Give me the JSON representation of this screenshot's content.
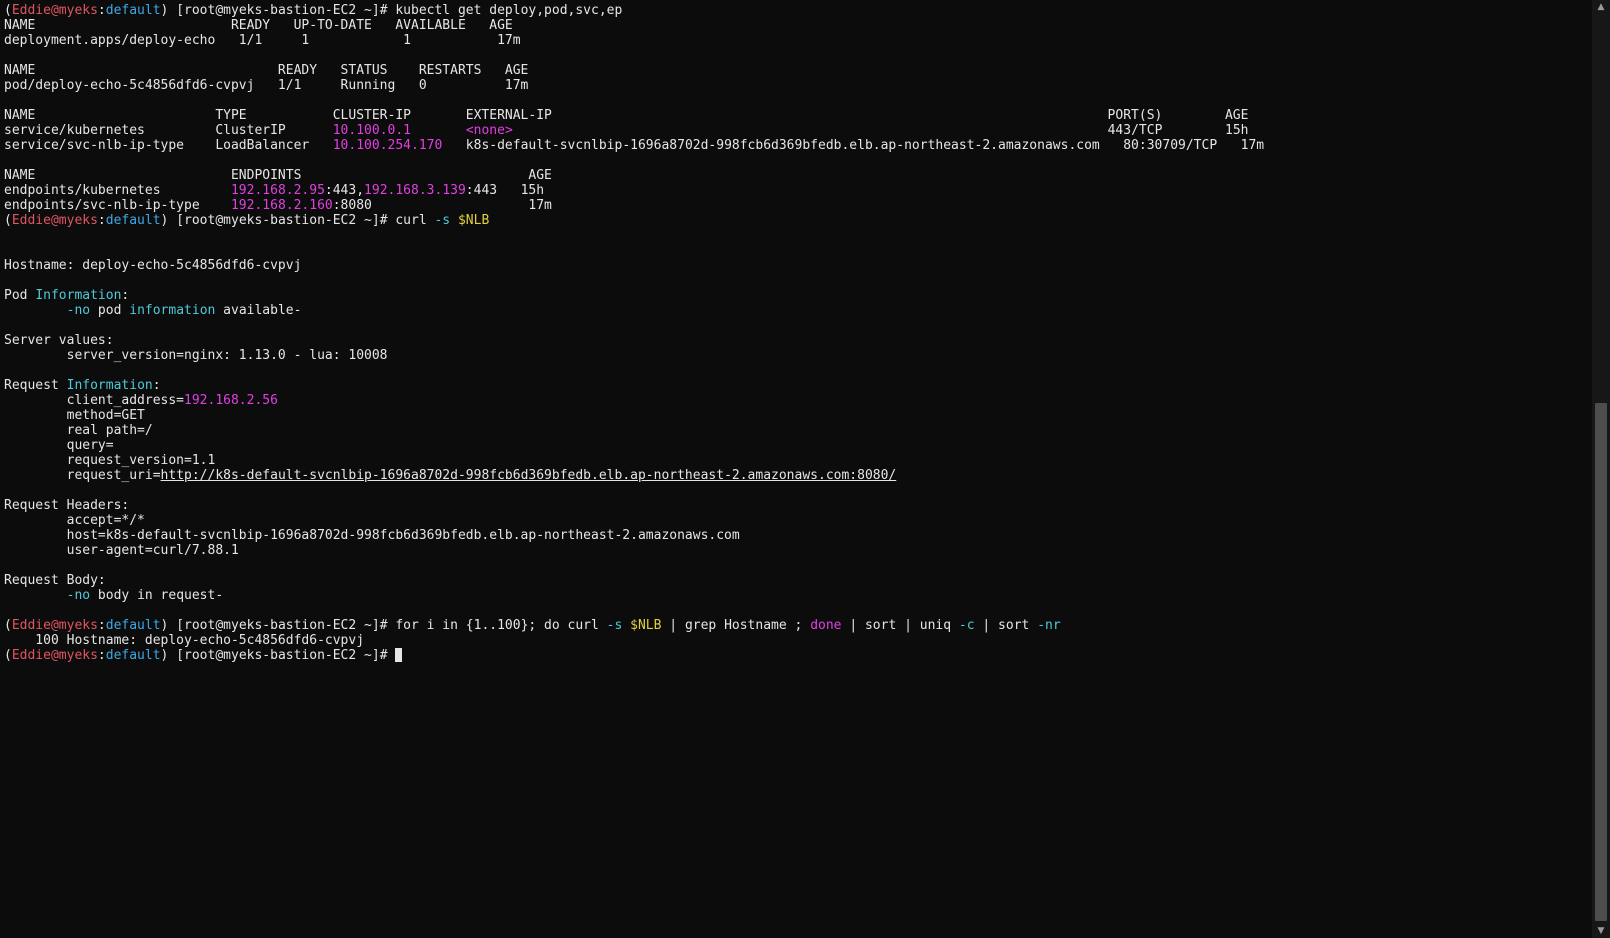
{
  "terminal": {
    "lines": [
      [
        {
          "t": "("
        },
        {
          "t": "Eddie@myeks",
          "c": "red"
        },
        {
          "t": ":"
        },
        {
          "t": "default",
          "c": "blue"
        },
        {
          "t": ") [root@myeks-bastion-EC2 ~]# kubectl get deploy,pod,svc,ep"
        }
      ],
      [
        {
          "t": "NAME                         READY   UP-TO-DATE   AVAILABLE   AGE"
        }
      ],
      [
        {
          "t": "deployment.apps/deploy-echo   1/1     1            1           17m"
        }
      ],
      [],
      [
        {
          "t": "NAME                               READY   STATUS    RESTARTS   AGE"
        }
      ],
      [
        {
          "t": "pod/deploy-echo-5c4856dfd6-cvpvj   1/1     Running   0          17m"
        }
      ],
      [],
      [
        {
          "t": "NAME                       TYPE           CLUSTER-IP       EXTERNAL-IP                                                                       PORT(S)        AGE"
        }
      ],
      [
        {
          "t": "service/kubernetes         ClusterIP      "
        },
        {
          "t": "10.100.0.1",
          "c": "magenta"
        },
        {
          "t": "       "
        },
        {
          "t": "<none>",
          "c": "magenta"
        },
        {
          "t": "                                                                            443/TCP        15h"
        }
      ],
      [
        {
          "t": "service/svc-nlb-ip-type    LoadBalancer   "
        },
        {
          "t": "10.100.254.170",
          "c": "magenta"
        },
        {
          "t": "   k8s-default-svcnlbip-1696a8702d-998fcb6d369bfedb.elb.ap-northeast-2.amazonaws.com   80:30709/TCP   17m"
        }
      ],
      [],
      [
        {
          "t": "NAME                         ENDPOINTS                             AGE"
        }
      ],
      [
        {
          "t": "endpoints/kubernetes         "
        },
        {
          "t": "192.168.2.95",
          "c": "magenta"
        },
        {
          "t": ":443,"
        },
        {
          "t": "192.168.3.139",
          "c": "magenta"
        },
        {
          "t": ":443   15h"
        }
      ],
      [
        {
          "t": "endpoints/svc-nlb-ip-type    "
        },
        {
          "t": "192.168.2.160",
          "c": "magenta"
        },
        {
          "t": ":8080                    17m"
        }
      ],
      [
        {
          "t": "("
        },
        {
          "t": "Eddie@myeks",
          "c": "red"
        },
        {
          "t": ":"
        },
        {
          "t": "default",
          "c": "blue"
        },
        {
          "t": ") [root@myeks-bastion-EC2 ~]# curl "
        },
        {
          "t": "-s",
          "c": "cyan"
        },
        {
          "t": " "
        },
        {
          "t": "$NLB",
          "c": "yellow"
        }
      ],
      [],
      [],
      [
        {
          "t": "Hostname: deploy-echo-5c4856dfd6-cvpvj"
        }
      ],
      [],
      [
        {
          "t": "Pod "
        },
        {
          "t": "Information",
          "c": "cyan"
        },
        {
          "t": ":"
        }
      ],
      [
        {
          "t": "        "
        },
        {
          "t": "-no",
          "c": "cyan"
        },
        {
          "t": " pod "
        },
        {
          "t": "information",
          "c": "cyan"
        },
        {
          "t": " available-"
        }
      ],
      [],
      [
        {
          "t": "Server values:"
        }
      ],
      [
        {
          "t": "        server_version=nginx: 1.13.0 - lua: 10008"
        }
      ],
      [],
      [
        {
          "t": "Request "
        },
        {
          "t": "Information",
          "c": "cyan"
        },
        {
          "t": ":"
        }
      ],
      [
        {
          "t": "        client_address="
        },
        {
          "t": "192.168.2.56",
          "c": "magenta"
        }
      ],
      [
        {
          "t": "        method=GET"
        }
      ],
      [
        {
          "t": "        real path=/"
        }
      ],
      [
        {
          "t": "        query="
        }
      ],
      [
        {
          "t": "        request_version=1.1"
        }
      ],
      [
        {
          "t": "        request_uri="
        },
        {
          "t": "http://k8s-default-svcnlbip-1696a8702d-998fcb6d369bfedb.elb.ap-northeast-2.amazonaws.com:8080/",
          "u": true
        }
      ],
      [],
      [
        {
          "t": "Request Headers:"
        }
      ],
      [
        {
          "t": "        accept=*/*"
        }
      ],
      [
        {
          "t": "        host=k8s-default-svcnlbip-1696a8702d-998fcb6d369bfedb.elb.ap-northeast-2.amazonaws.com"
        }
      ],
      [
        {
          "t": "        user-agent=curl/7.88.1"
        }
      ],
      [],
      [
        {
          "t": "Request Body:"
        }
      ],
      [
        {
          "t": "        "
        },
        {
          "t": "-no",
          "c": "cyan"
        },
        {
          "t": " body in request-"
        }
      ],
      [],
      [
        {
          "t": "("
        },
        {
          "t": "Eddie@myeks",
          "c": "red"
        },
        {
          "t": ":"
        },
        {
          "t": "default",
          "c": "blue"
        },
        {
          "t": ") [root@myeks-bastion-EC2 ~]# for i in {1..100}; do curl "
        },
        {
          "t": "-s",
          "c": "cyan"
        },
        {
          "t": " "
        },
        {
          "t": "$NLB",
          "c": "yellow"
        },
        {
          "t": " | grep Hostname ; "
        },
        {
          "t": "done",
          "c": "magenta"
        },
        {
          "t": " | sort | uniq "
        },
        {
          "t": "-c",
          "c": "cyan"
        },
        {
          "t": " | sort "
        },
        {
          "t": "-nr",
          "c": "cyan"
        }
      ],
      [
        {
          "t": "    100 Hostname: deploy-echo-5c4856dfd6-cvpvj"
        }
      ],
      [
        {
          "t": "("
        },
        {
          "t": "Eddie@myeks",
          "c": "red"
        },
        {
          "t": ":"
        },
        {
          "t": "default",
          "c": "blue"
        },
        {
          "t": ") [root@myeks-bastion-EC2 ~]# "
        },
        {
          "cursor": true
        }
      ]
    ]
  },
  "scrollbar": {
    "up_arrow_icon": "▲",
    "down_arrow_icon": "▼"
  },
  "colors": {
    "background": "#0c0c0c",
    "foreground": "#e6e6e6",
    "prompt_user": "#e05561",
    "prompt_context": "#3ea8e6",
    "ip_address": "#e040e0",
    "variable": "#e0d040",
    "flag": "#4ec9d8"
  }
}
